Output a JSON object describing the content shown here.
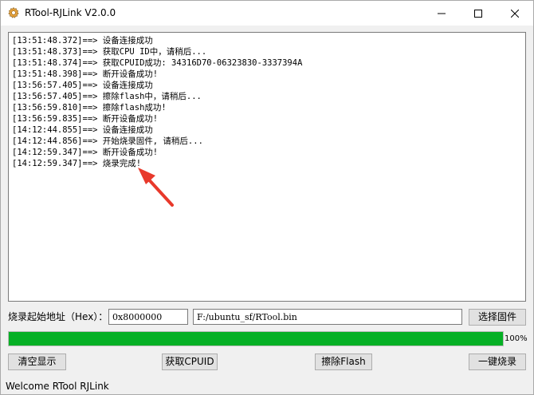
{
  "window": {
    "title": "RTool-RJLink V2.0.0"
  },
  "log": {
    "lines": [
      "[13:51:48.372]==> 设备连接成功",
      "[13:51:48.373]==> 获取CPU ID中，请稍后...",
      "[13:51:48.374]==> 获取CPUID成功: 34316D70-06323830-3337394A",
      "[13:51:48.398]==> 断开设备成功!",
      "[13:56:57.405]==> 设备连接成功",
      "[13:56:57.405]==> 擦除flash中，请稍后...",
      "[13:56:59.810]==> 擦除flash成功!",
      "[13:56:59.835]==> 断开设备成功!",
      "[14:12:44.855]==> 设备连接成功",
      "[14:12:44.856]==> 开始烧录固件, 请稍后...",
      "[14:12:59.347]==> 断开设备成功!",
      "[14:12:59.347]==> 烧录完成!"
    ]
  },
  "flash": {
    "address_label": "烧录起始地址（Hex）：",
    "address_value": "0x8000000",
    "file_path": "F:/ubuntu_sf/RTool.bin",
    "select_label": "选择固件"
  },
  "progress": {
    "percent": 100,
    "label": "100%"
  },
  "actions": {
    "clear_label": "清空显示",
    "cpuid_label": "获取CPUID",
    "erase_label": "擦除Flash",
    "burn_label": "一键烧录"
  },
  "status": {
    "text": "Welcome RTool RJLink"
  },
  "colors": {
    "progress_fill": "#06b025",
    "arrow": "#e8392b"
  },
  "icons": {
    "app": "gear-icon",
    "minimize": "minimize-icon",
    "maximize": "maximize-icon",
    "close": "close-icon",
    "annotation": "arrow-annotation"
  }
}
